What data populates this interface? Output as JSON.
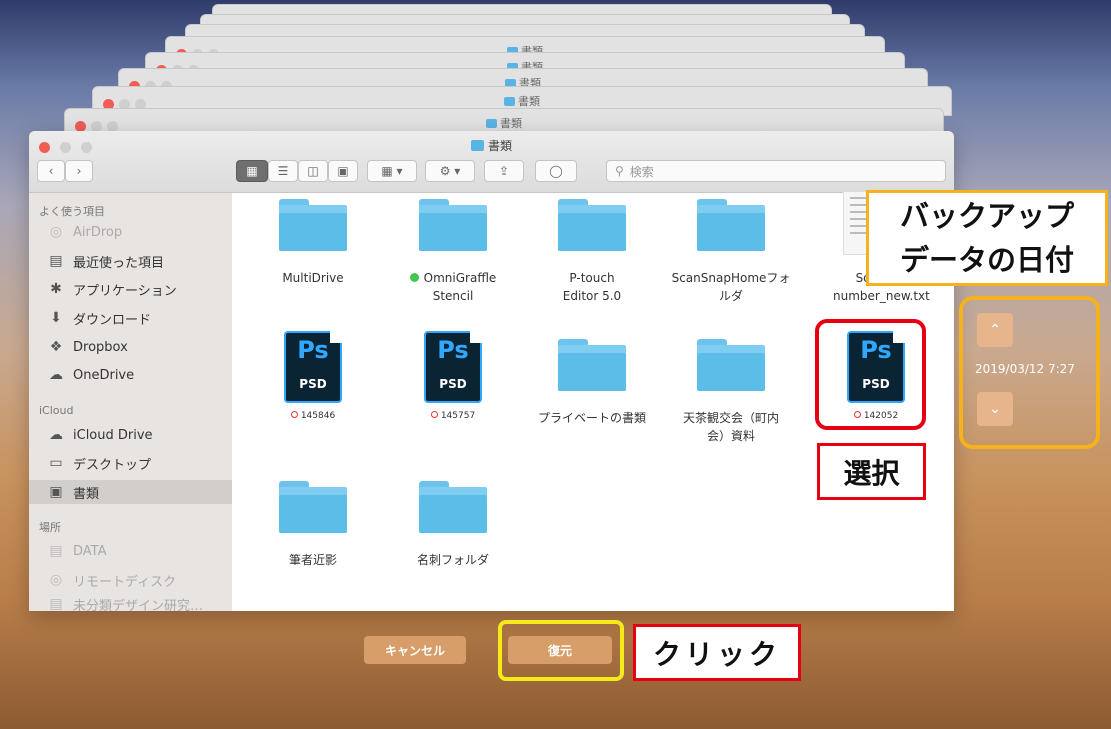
{
  "stack": {
    "title": "書類"
  },
  "window": {
    "title": "書類"
  },
  "toolbar": {
    "back_icon": "chevron-left-icon",
    "forward_icon": "chevron-right-icon",
    "search_placeholder": "検索"
  },
  "sidebar": {
    "favorites_header": "よく使う項目",
    "favorites": [
      {
        "label": "AirDrop",
        "icon": "airdrop-icon"
      },
      {
        "label": "最近使った項目",
        "icon": "recents-icon"
      },
      {
        "label": "アプリケーション",
        "icon": "applications-icon"
      },
      {
        "label": "ダウンロード",
        "icon": "download-icon"
      },
      {
        "label": "Dropbox",
        "icon": "dropbox-icon"
      },
      {
        "label": "OneDrive",
        "icon": "onedrive-icon"
      }
    ],
    "icloud_header": "iCloud",
    "icloud": [
      {
        "label": "iCloud Drive",
        "icon": "cloud-icon"
      },
      {
        "label": "デスクトップ",
        "icon": "desktop-icon"
      },
      {
        "label": "書類",
        "icon": "documents-icon"
      }
    ],
    "places_header": "場所",
    "places": [
      {
        "label": "DATA",
        "icon": "disk-icon"
      },
      {
        "label": "リモートディスク",
        "icon": "remote-disc-icon"
      },
      {
        "label": "未分類デザイン研究…",
        "icon": "disk-icon"
      }
    ]
  },
  "files": [
    {
      "name": "MultiDrive",
      "type": "folder"
    },
    {
      "name": "OmniGraffle Stencil",
      "type": "folder",
      "tag": "green"
    },
    {
      "name": "P-touch Editor 5.0",
      "type": "folder"
    },
    {
      "name": "ScanSnapHomeフォルダ",
      "type": "folder"
    },
    {
      "name": "Softwa number_new.txt",
      "type": "document"
    },
    {
      "name": "145846",
      "type": "psd"
    },
    {
      "name": "145757",
      "type": "psd"
    },
    {
      "name": "プライベートの書類",
      "type": "folder"
    },
    {
      "name": "天茶観交会（町内会）資料",
      "type": "folder"
    },
    {
      "name": "142052",
      "type": "psd"
    },
    {
      "name": "筆者近影",
      "type": "folder"
    },
    {
      "name": "名刺フォルダ",
      "type": "folder"
    }
  ],
  "psd_label": {
    "ps": "Ps",
    "ext": "PSD"
  },
  "buttons": {
    "cancel": "キャンセル",
    "restore": "復元"
  },
  "timemachine": {
    "date": "2019/03/12 7:27"
  },
  "annotations": {
    "click": "クリック",
    "select": "選択",
    "backup_date_line1": "バックアップ",
    "backup_date_line2": "データの日付"
  },
  "colors": {
    "highlight_red": "#e60012",
    "highlight_yellow": "#f4ea1a",
    "highlight_orange": "#f5b21c",
    "folder": "#5cbde9"
  }
}
